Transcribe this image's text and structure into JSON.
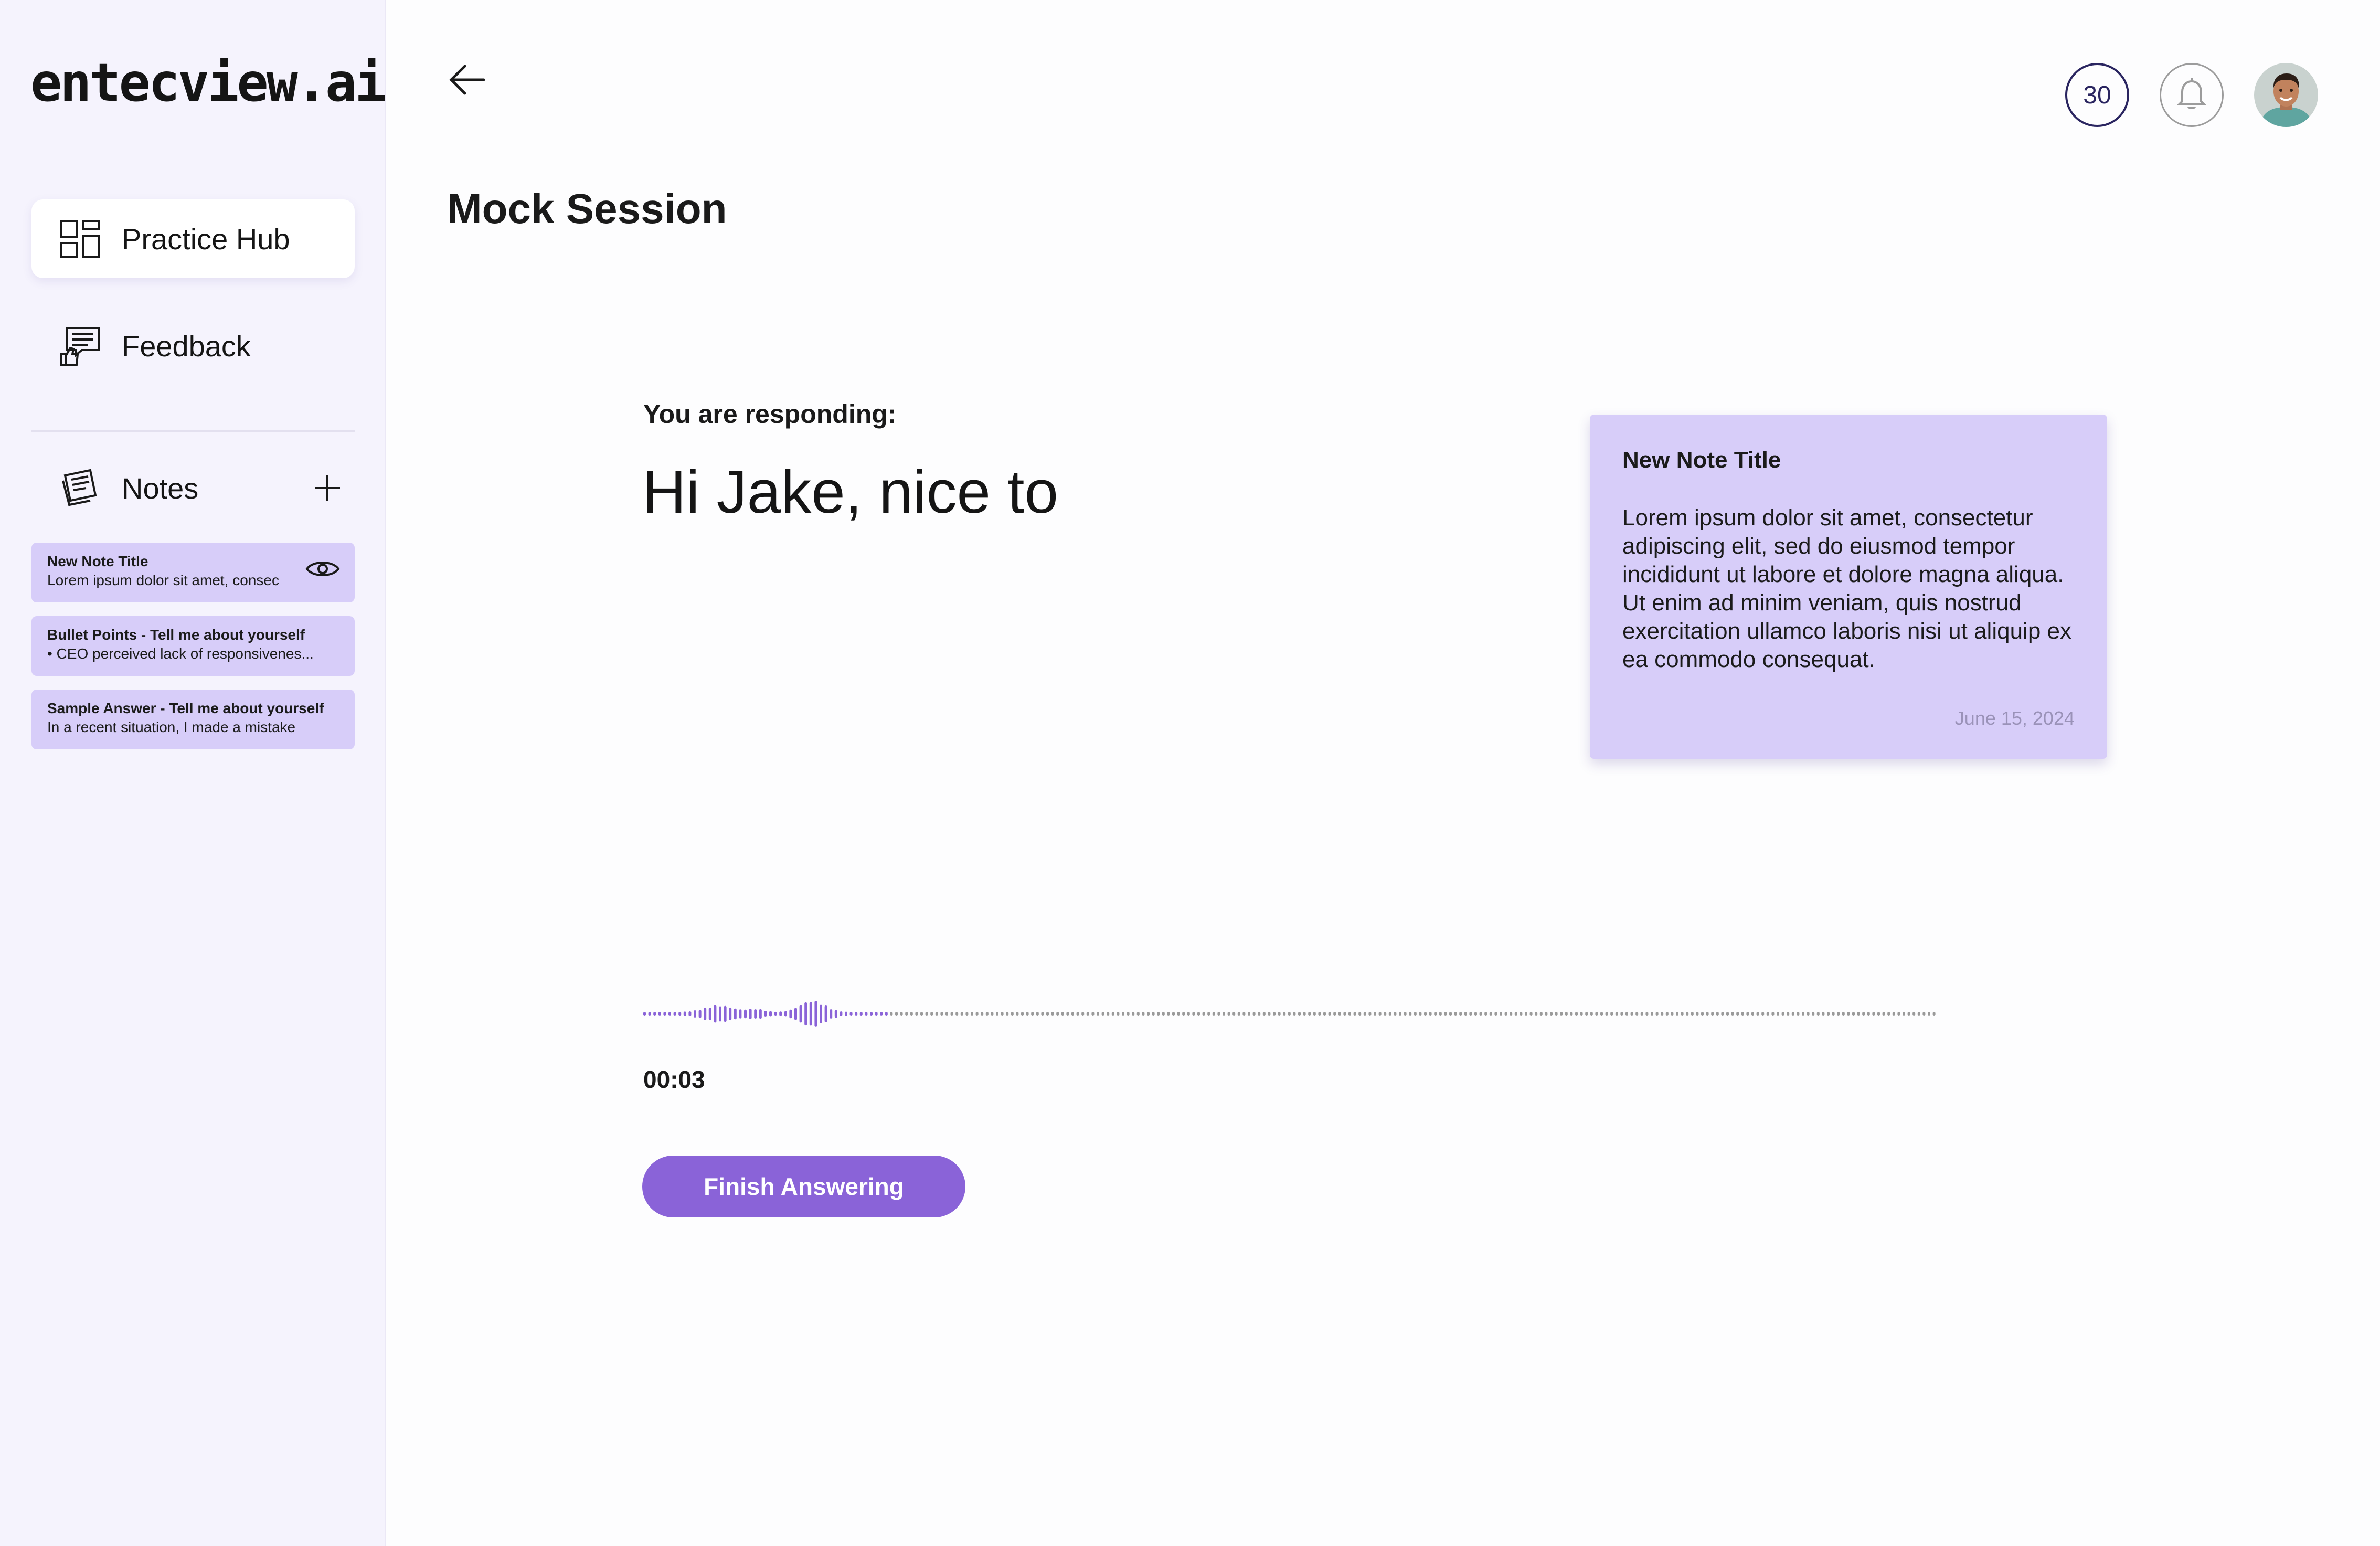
{
  "app": {
    "logo_text": "entecview.ai"
  },
  "sidebar": {
    "nav": [
      {
        "label": "Practice Hub",
        "icon": "grid-icon",
        "active": true
      },
      {
        "label": "Feedback",
        "icon": "feedback-icon",
        "active": false
      }
    ],
    "notes_label": "Notes",
    "notes": [
      {
        "title": "New Note Title",
        "preview": "Lorem ipsum dolor sit amet, consec"
      },
      {
        "title": "Bullet Points - Tell me about yourself",
        "preview": "•  CEO perceived lack of responsivenes..."
      },
      {
        "title": "Sample Answer - Tell me about yourself",
        "preview": "In a recent situation, I made a mistake"
      }
    ]
  },
  "header": {
    "credits": "30",
    "page_title": "Mock Session"
  },
  "session": {
    "responding_label": "You are responding:",
    "transcript": "Hi Jake, nice to",
    "timer": "00:03",
    "finish_label": "Finish Answering"
  },
  "note_popup": {
    "title": "New Note Title",
    "body": "Lorem ipsum dolor sit amet, consectetur adipiscing elit, sed do eiusmod tempor incididunt ut labore et dolore magna aliqua. Ut enim ad minim veniam, quis nostrud exercitation ullamco laboris nisi ut aliquip ex ea commodo consequat.",
    "date": "June 15, 2024"
  },
  "colors": {
    "accent": "#8a63d8",
    "note_bg": "#d7cdf9",
    "sidebar_bg": "#f5f3fd",
    "wave_played": "#8a63d8",
    "wave_pending": "#9a9a9a"
  },
  "waveform": {
    "played_fraction": 0.19
  }
}
